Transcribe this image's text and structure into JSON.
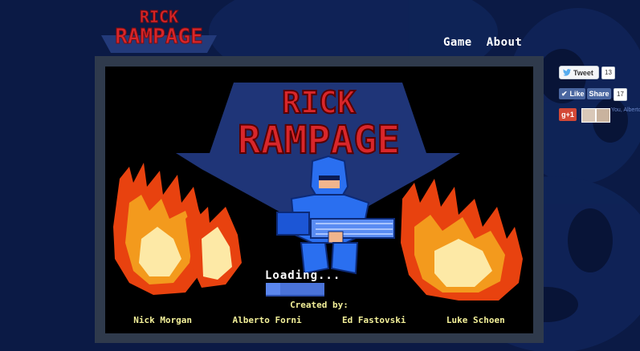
{
  "site": {
    "logo_text": [
      "RICK",
      "RAMPAGE"
    ]
  },
  "nav": {
    "items": [
      "Game",
      "About"
    ]
  },
  "game": {
    "title_line1": "RICK",
    "title_line2": "RAMPAGE",
    "loading_text": "Loading...",
    "loading_progress": 0.25,
    "credits_title": "Created by:",
    "credits": [
      "Nick Morgan",
      "Alberto Forni",
      "Ed Fastovski",
      "Luke Schoen"
    ]
  },
  "social": {
    "tweet_label": "Tweet",
    "tweet_count": "13",
    "like_label": "Like",
    "share_label": "Share",
    "share_count": "17",
    "gplus_label": "g+1",
    "you_text": "You, Alberto"
  },
  "colors": {
    "page_bg": "#0b1a45",
    "frame": "#2f3a4c",
    "logo_red": "#d8262a",
    "logo_navy": "#233a7a",
    "credits_yellow": "#f3f099"
  }
}
